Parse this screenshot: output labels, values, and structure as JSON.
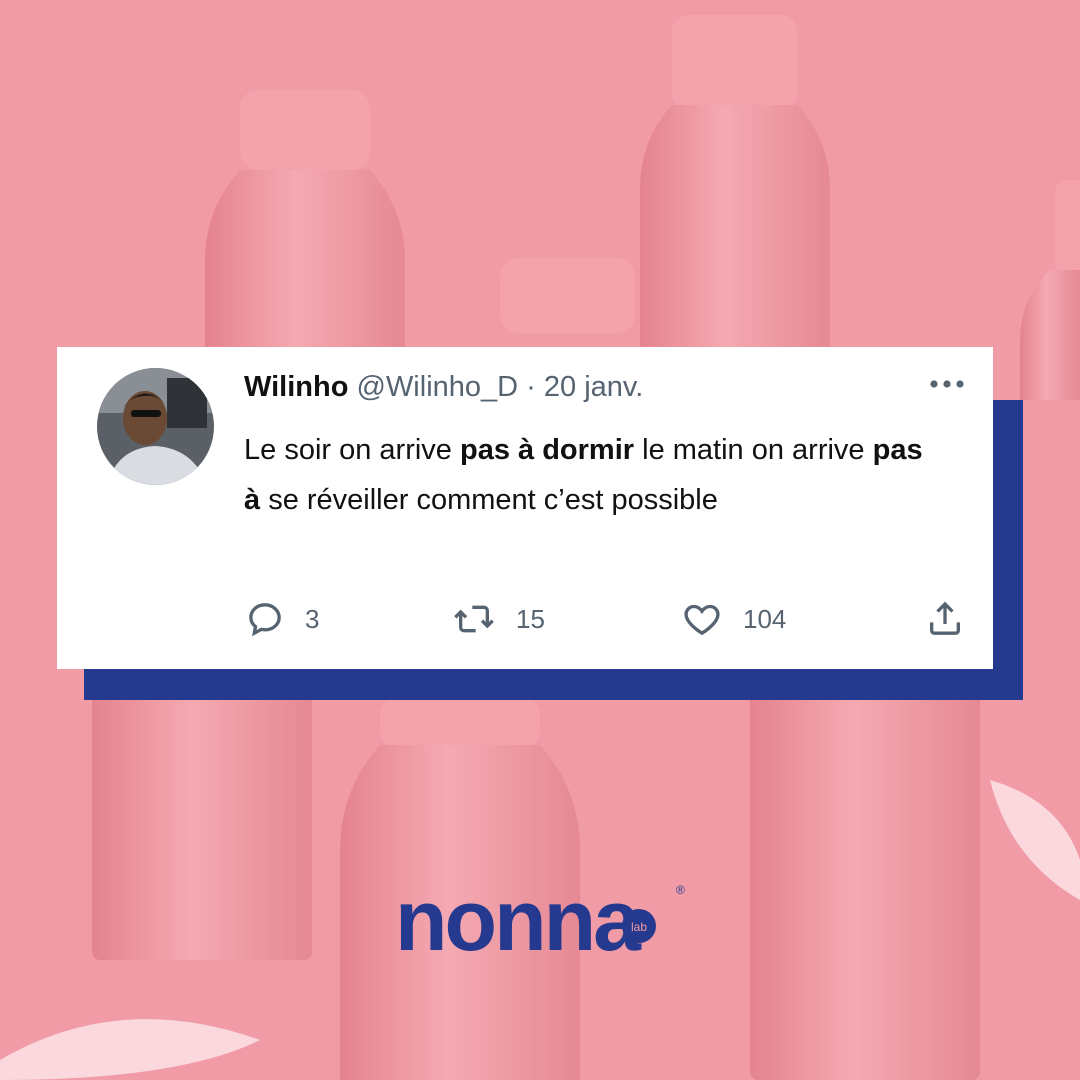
{
  "tweet": {
    "display_name": "Wilinho",
    "handle": "@Wilinho_D",
    "separator": "·",
    "date": "20 janv.",
    "text_parts": {
      "p1": "Le soir on arrive ",
      "b1": "pas à dormir",
      "p2": " le matin on arrive ",
      "b2": "pas à",
      "p3": " se réveiller comment c’est possible"
    },
    "replies": "3",
    "retweets": "15",
    "likes": "104"
  },
  "icons": {
    "more": "more-dots-icon",
    "reply": "reply-bubble-icon",
    "retweet": "retweet-icon",
    "like": "heart-icon",
    "share": "share-icon"
  },
  "brand": {
    "logo_text": "nonna",
    "logo_badge": "lab",
    "registered": "®",
    "color": "#253a8e"
  },
  "colors": {
    "background": "#f19aa6",
    "accent_box": "#253a8e",
    "muted_text": "#566370"
  }
}
